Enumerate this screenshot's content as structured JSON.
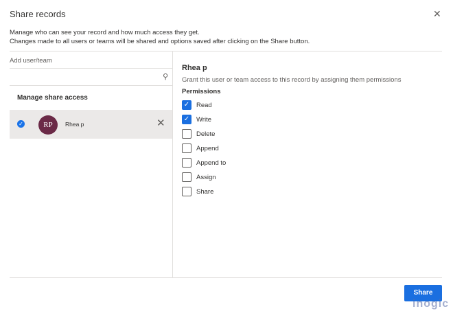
{
  "dialog": {
    "title": "Share records",
    "close_icon": "close-icon",
    "description_line1": "Manage who can see your record and how much access they get.",
    "description_line2": "Changes made to all users or teams will be shared and options saved after clicking on the Share button."
  },
  "left": {
    "add_label": "Add user/team",
    "search_value": "",
    "manage_label": "Manage share access",
    "user": {
      "initials": "RP",
      "name": "Rhea p",
      "avatar_color": "#6b2a47",
      "selected": true
    }
  },
  "right": {
    "name": "Rhea p",
    "grant_text": "Grant this user or team access to this record by assigning them permissions",
    "permissions_label": "Permissions",
    "permissions": [
      {
        "label": "Read",
        "checked": true
      },
      {
        "label": "Write",
        "checked": true
      },
      {
        "label": "Delete",
        "checked": false
      },
      {
        "label": "Append",
        "checked": false
      },
      {
        "label": "Append to",
        "checked": false
      },
      {
        "label": "Assign",
        "checked": false
      },
      {
        "label": "Share",
        "checked": false
      }
    ]
  },
  "footer": {
    "share_label": "Share",
    "accent": "#1a6fe0"
  },
  "watermark": "inogic"
}
